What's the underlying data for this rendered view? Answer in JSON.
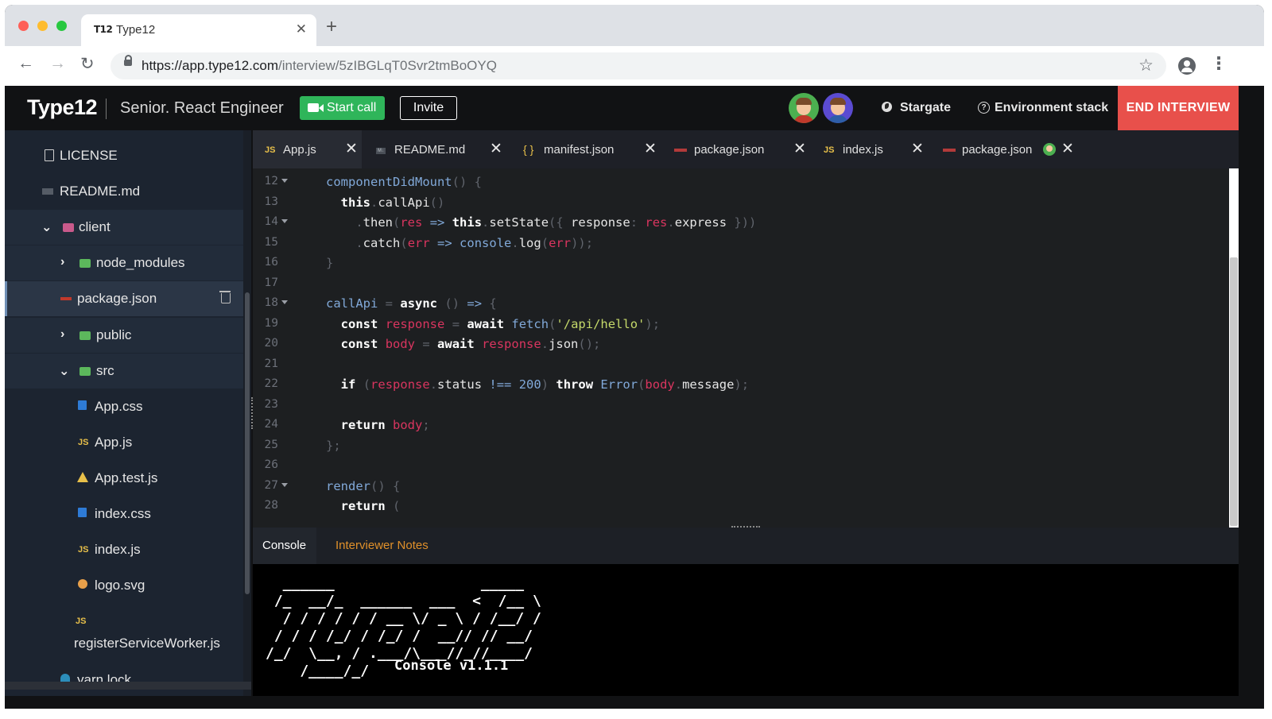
{
  "browser": {
    "tab_title": "Type12",
    "tab_favicon": "T12",
    "url_host": "https://app.type12.com",
    "url_path": "/interview/5zIBGLqT0Svr2tmBoOYQ"
  },
  "header": {
    "logo": "Type12",
    "role": "Senior. React Engineer",
    "start_call": "Start call",
    "invite": "Invite",
    "stargate": "Stargate",
    "environment": "Environment stack",
    "end_interview": "END INTERVIEW"
  },
  "sidebar": {
    "items": [
      {
        "label": "LICENSE",
        "icon": "document-icon"
      },
      {
        "label": "README.md",
        "icon": "markdown-icon"
      },
      {
        "label": "client",
        "icon": "folder-icon"
      },
      {
        "label": "node_modules",
        "icon": "node-folder-icon"
      },
      {
        "label": "package.json",
        "icon": "package-icon"
      },
      {
        "label": "public",
        "icon": "folder-icon"
      },
      {
        "label": "src",
        "icon": "folder-icon"
      },
      {
        "label": "App.css",
        "icon": "css-icon"
      },
      {
        "label": "App.js",
        "icon": "js-icon"
      },
      {
        "label": "App.test.js",
        "icon": "test-icon"
      },
      {
        "label": "index.css",
        "icon": "css-icon"
      },
      {
        "label": "index.js",
        "icon": "js-icon"
      },
      {
        "label": "logo.svg",
        "icon": "svg-icon"
      },
      {
        "label": "registerServiceWorker.js",
        "icon": "js-icon"
      },
      {
        "label": "yarn.lock",
        "icon": "yarn-icon"
      }
    ],
    "js_badge": "JS",
    "md_badge": "M↓"
  },
  "editor": {
    "tabs": [
      {
        "label": "App.js"
      },
      {
        "label": "README.md"
      },
      {
        "label": "manifest.json"
      },
      {
        "label": "package.json"
      },
      {
        "label": "index.js"
      },
      {
        "label": "package.json"
      }
    ],
    "js_badge": "JS",
    "brace_badge": "{ }",
    "md_badge": "M↓",
    "line_numbers": [
      "12",
      "13",
      "14",
      "15",
      "16",
      "17",
      "18",
      "19",
      "20",
      "21",
      "22",
      "23",
      "24",
      "25",
      "26",
      "27",
      "28"
    ]
  },
  "console": {
    "tabs": {
      "console": "Console",
      "notes": "Interviewer Notes"
    },
    "ascii_art": "  ______                 _____\n /_  __/_  ______  ___  <  /__ \\\n  / / / / / / __ \\/ _ \\ / /__/ /\n / / / /_/ / /_/ /  __// // __/\n/_/  \\__, / .___/\\___//_//____/\n    /____/_/",
    "version": "Console v1.1.1"
  }
}
